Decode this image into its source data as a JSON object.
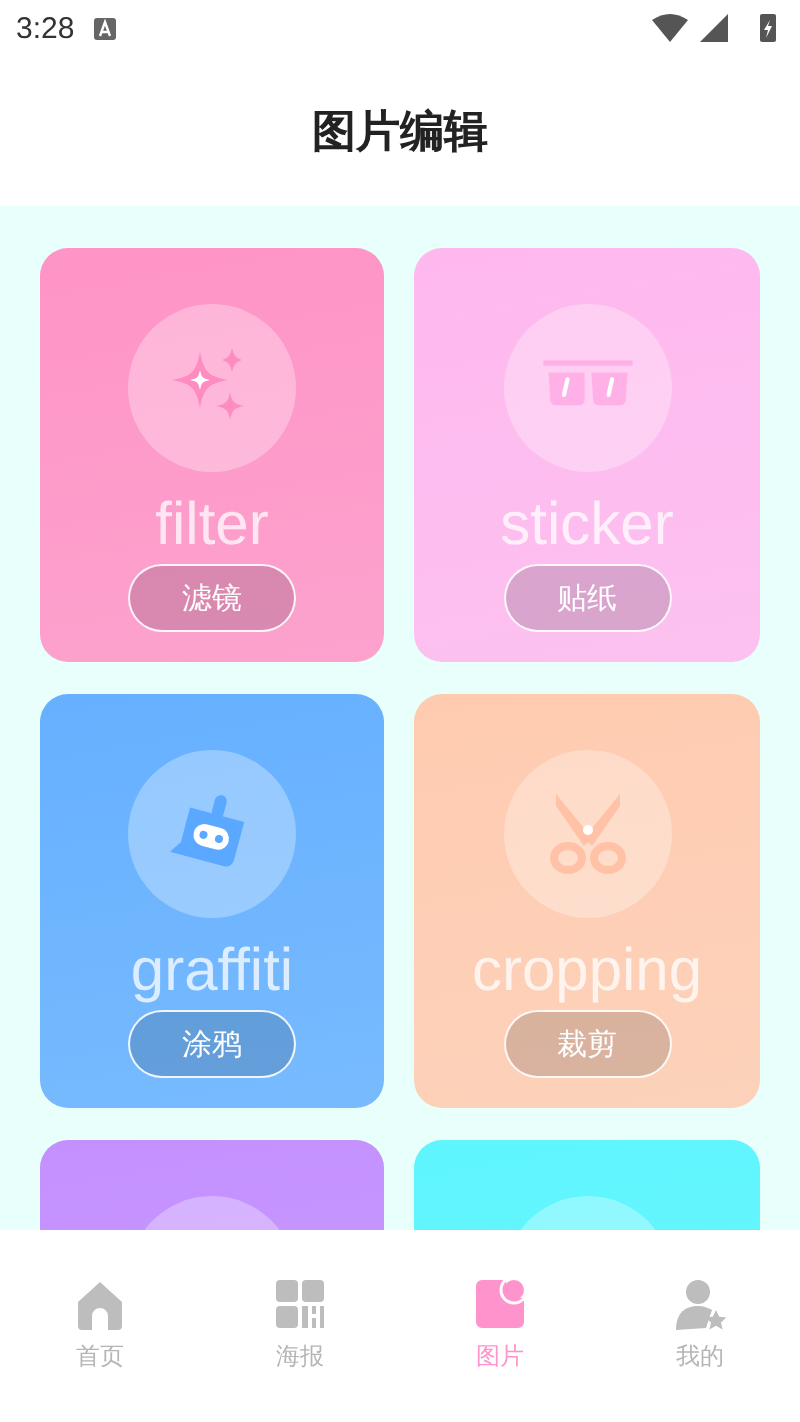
{
  "status_bar": {
    "time": "3:28"
  },
  "header": {
    "title": "图片编辑"
  },
  "cards": [
    {
      "kind": "filter",
      "color": "#ff94c6",
      "word": "filter",
      "label": "滤镜"
    },
    {
      "kind": "sticker",
      "color": "#ffb8ee",
      "word": "sticker",
      "label": "贴纸"
    },
    {
      "kind": "graffiti",
      "color": "#66b0ff",
      "word": "graffiti",
      "label": "涂鸦"
    },
    {
      "kind": "cropping",
      "color": "#ffcbb0",
      "word": "cropping",
      "label": "裁剪"
    },
    {
      "kind": "blank",
      "color": "#c490ff"
    },
    {
      "kind": "blank",
      "color": "#5ef5ff"
    }
  ],
  "nav": [
    {
      "kind": "home",
      "label": "首页",
      "selected": false
    },
    {
      "kind": "poster",
      "label": "海报",
      "selected": false
    },
    {
      "kind": "picture",
      "label": "图片",
      "selected": true
    },
    {
      "kind": "mine",
      "label": "我的",
      "selected": false
    }
  ]
}
